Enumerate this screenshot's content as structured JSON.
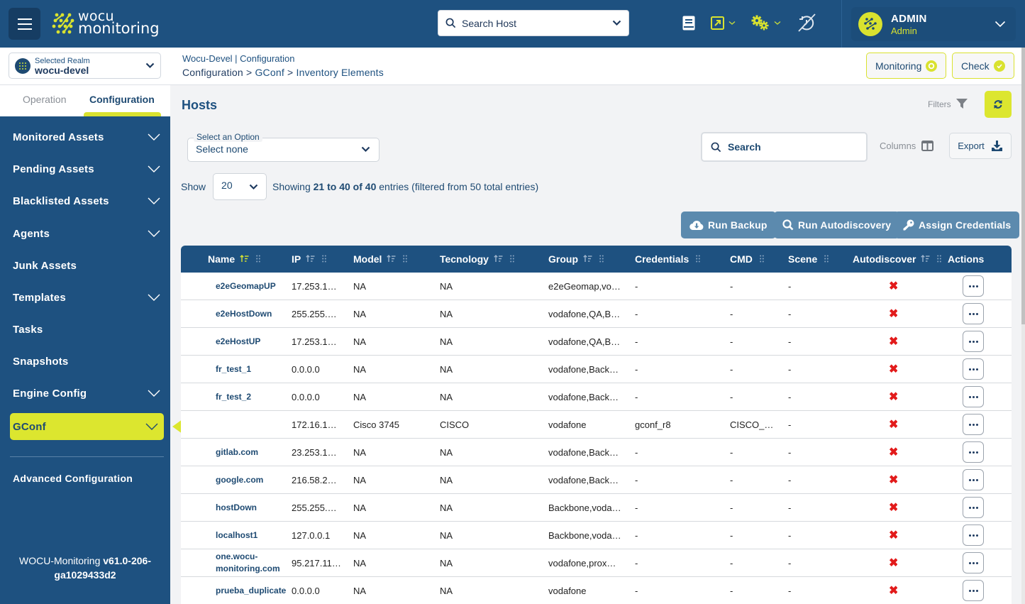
{
  "app": {
    "logo_line1": "wocu",
    "logo_line2": "monitoring"
  },
  "topbar": {
    "host_search_placeholder": "Search Host",
    "icons": [
      "book-icon",
      "external-link-icon",
      "gears-icon",
      "sync-disabled-icon"
    ],
    "user": {
      "name": "ADMIN",
      "role": "Admin"
    }
  },
  "realm": {
    "label": "Selected Realm",
    "value": "wocu-devel"
  },
  "breadcrumb": {
    "top": "Wocu-Devel | Configuration",
    "items": [
      "Configuration",
      "GConf",
      "Inventory Elements"
    ],
    "separator": ">"
  },
  "header_buttons": {
    "monitoring": "Monitoring",
    "check": "Check"
  },
  "sidebar": {
    "tabs": [
      {
        "label": "Operation",
        "active": false
      },
      {
        "label": "Configuration",
        "active": true
      }
    ],
    "items": [
      {
        "label": "Monitored Assets",
        "expandable": true
      },
      {
        "label": "Pending Assets",
        "expandable": true
      },
      {
        "label": "Blacklisted Assets",
        "expandable": true
      },
      {
        "label": "Agents",
        "expandable": true
      },
      {
        "label": "Junk Assets",
        "expandable": false
      },
      {
        "label": "Templates",
        "expandable": true
      },
      {
        "label": "Tasks",
        "expandable": false
      },
      {
        "label": "Snapshots",
        "expandable": false
      },
      {
        "label": "Engine Config",
        "expandable": true
      },
      {
        "label": "GConf",
        "expandable": true,
        "active": true
      }
    ],
    "advanced": "Advanced Configuration",
    "version_prefix": "WOCU-Monitoring ",
    "version_bold": "v61.0-206-",
    "version_line2": "ga1029433d2"
  },
  "main": {
    "title": "Hosts",
    "filters_label": "Filters",
    "select_option": {
      "label": "Select an Option",
      "value": "Select none"
    },
    "search_placeholder": "Search",
    "columns_label": "Columns",
    "export_label": "Export",
    "show_label": "Show",
    "page_size": "20",
    "showing": {
      "prefix": "Showing ",
      "from": "21",
      "to_word": " to ",
      "to": "40",
      "of_word": " of ",
      "total": "40",
      "suffix": " entries (filtered from 50 total entries)"
    },
    "actions": {
      "run_backup": "Run Backup",
      "run_autodiscovery": "Run Autodiscovery",
      "assign_credentials": "Assign Credentials"
    }
  },
  "table": {
    "columns": [
      {
        "key": "name",
        "label": "Name",
        "sortable": true,
        "sorted": true
      },
      {
        "key": "ip",
        "label": "IP",
        "sortable": true
      },
      {
        "key": "model",
        "label": "Model",
        "sortable": true
      },
      {
        "key": "tecnology",
        "label": "Tecnology",
        "sortable": true
      },
      {
        "key": "group",
        "label": "Group",
        "sortable": true
      },
      {
        "key": "credentials",
        "label": "Credentials",
        "sortable": false
      },
      {
        "key": "cmd",
        "label": "CMD",
        "sortable": false
      },
      {
        "key": "scene",
        "label": "Scene",
        "sortable": false
      },
      {
        "key": "autodiscover",
        "label": "Autodiscover",
        "sortable": true
      },
      {
        "key": "actions",
        "label": "Actions",
        "sortable": false
      }
    ],
    "rows": [
      {
        "name": "e2eGeomapUP",
        "ip": "17.253.1…",
        "model": "NA",
        "tecnology": "NA",
        "group": "e2eGeomap,vo…",
        "credentials": "-",
        "cmd": "-",
        "scene": "-",
        "autodiscover": "✖"
      },
      {
        "name": "e2eHostDown",
        "ip": "255.255.…",
        "model": "NA",
        "tecnology": "NA",
        "group": "vodafone,QA,B…",
        "credentials": "-",
        "cmd": "-",
        "scene": "-",
        "autodiscover": "✖"
      },
      {
        "name": "e2eHostUP",
        "ip": "17.253.1…",
        "model": "NA",
        "tecnology": "NA",
        "group": "vodafone,QA,B…",
        "credentials": "-",
        "cmd": "-",
        "scene": "-",
        "autodiscover": "✖"
      },
      {
        "name": "fr_test_1",
        "ip": "0.0.0.0",
        "model": "NA",
        "tecnology": "NA",
        "group": "vodafone,Back…",
        "credentials": "-",
        "cmd": "-",
        "scene": "-",
        "autodiscover": "✖"
      },
      {
        "name": "fr_test_2",
        "ip": "0.0.0.0",
        "model": "NA",
        "tecnology": "NA",
        "group": "vodafone,Back…",
        "credentials": "-",
        "cmd": "-",
        "scene": "-",
        "autodiscover": "✖"
      },
      {
        "name": "",
        "ip": "172.16.1…",
        "model": "Cisco 3745",
        "tecnology": "CISCO",
        "group": "vodafone",
        "credentials": "gconf_r8",
        "cmd": "CISCO_…",
        "scene": "-",
        "autodiscover": "✖"
      },
      {
        "name": "gitlab.com",
        "ip": "23.253.1…",
        "model": "NA",
        "tecnology": "NA",
        "group": "vodafone,Back…",
        "credentials": "-",
        "cmd": "-",
        "scene": "-",
        "autodiscover": "✖"
      },
      {
        "name": "google.com",
        "ip": "216.58.2…",
        "model": "NA",
        "tecnology": "NA",
        "group": "vodafone,Back…",
        "credentials": "-",
        "cmd": "-",
        "scene": "-",
        "autodiscover": "✖"
      },
      {
        "name": "hostDown",
        "ip": "255.255.…",
        "model": "NA",
        "tecnology": "NA",
        "group": "Backbone,voda…",
        "credentials": "-",
        "cmd": "-",
        "scene": "-",
        "autodiscover": "✖"
      },
      {
        "name": "localhost1",
        "ip": "127.0.0.1",
        "model": "NA",
        "tecnology": "NA",
        "group": "Backbone,voda…",
        "credentials": "-",
        "cmd": "-",
        "scene": "-",
        "autodiscover": "✖"
      },
      {
        "name": "one.wocu-monitoring.com",
        "ip": "95.217.11…",
        "model": "NA",
        "tecnology": "NA",
        "group": "vodafone,prox…",
        "credentials": "-",
        "cmd": "-",
        "scene": "-",
        "autodiscover": "✖"
      },
      {
        "name": "prueba_duplicate",
        "ip": "0.0.0.0",
        "model": "NA",
        "tecnology": "NA",
        "group": "vodafone",
        "credentials": "-",
        "cmd": "-",
        "scene": "-",
        "autodiscover": "✖"
      }
    ]
  },
  "colors": {
    "brand_blue": "#1e5180",
    "accent_yellow": "#dce62f",
    "action_button": "#5c8aae",
    "error_red": "#e21b1b"
  }
}
